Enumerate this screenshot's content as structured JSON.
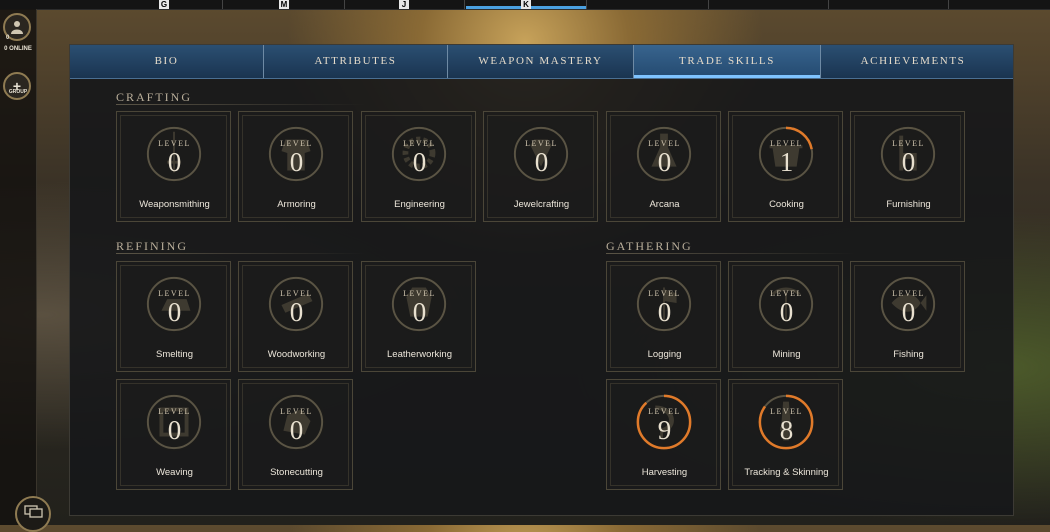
{
  "keybar": {
    "keys": [
      "G",
      "M",
      "J",
      "K"
    ]
  },
  "sidebar": {
    "online_count": "0",
    "online_label": "0 ONLINE",
    "group_label": "GROUP"
  },
  "tabs": [
    {
      "label": "BIO",
      "active": false
    },
    {
      "label": "ATTRIBUTES",
      "active": false
    },
    {
      "label": "WEAPON MASTERY",
      "active": false
    },
    {
      "label": "TRADE SKILLS",
      "active": true
    },
    {
      "label": "ACHIEVEMENTS",
      "active": false
    }
  ],
  "sections": {
    "crafting": "CRAFTING",
    "refining": "REFINING",
    "gathering": "GATHERING"
  },
  "level_label": "LEVEL",
  "skills": [
    {
      "name": "Weaponsmithing",
      "level": "0",
      "progress": 0,
      "icon": "sword-icon"
    },
    {
      "name": "Armoring",
      "level": "0",
      "progress": 0,
      "icon": "armor-icon"
    },
    {
      "name": "Engineering",
      "level": "0",
      "progress": 0,
      "icon": "gear-icon"
    },
    {
      "name": "Jewelcrafting",
      "level": "0",
      "progress": 0,
      "icon": "gem-icon"
    },
    {
      "name": "Arcana",
      "level": "0",
      "progress": 0,
      "icon": "flask-icon"
    },
    {
      "name": "Cooking",
      "level": "1",
      "progress": 0.22,
      "icon": "pot-icon"
    },
    {
      "name": "Furnishing",
      "level": "0",
      "progress": 0,
      "icon": "chair-icon"
    },
    {
      "name": "Smelting",
      "level": "0",
      "progress": 0,
      "icon": "ingot-icon"
    },
    {
      "name": "Woodworking",
      "level": "0",
      "progress": 0,
      "icon": "plank-icon"
    },
    {
      "name": "Leatherworking",
      "level": "0",
      "progress": 0,
      "icon": "hide-icon"
    },
    {
      "name": "Weaving",
      "level": "0",
      "progress": 0,
      "icon": "cloth-icon"
    },
    {
      "name": "Stonecutting",
      "level": "0",
      "progress": 0,
      "icon": "stone-icon"
    },
    {
      "name": "Logging",
      "level": "0",
      "progress": 0,
      "icon": "axe-icon"
    },
    {
      "name": "Mining",
      "level": "0",
      "progress": 0,
      "icon": "pickaxe-icon"
    },
    {
      "name": "Fishing",
      "level": "0",
      "progress": 0,
      "icon": "fish-icon"
    },
    {
      "name": "Harvesting",
      "level": "9",
      "progress": 0.88,
      "icon": "sickle-icon"
    },
    {
      "name": "Tracking & Skinning",
      "level": "8",
      "progress": 0.85,
      "icon": "knife-icon"
    }
  ],
  "colors": {
    "progress_ring": "#e07a2a",
    "ring_base": "#5a5444",
    "tab_active": "#7ec3ff"
  }
}
